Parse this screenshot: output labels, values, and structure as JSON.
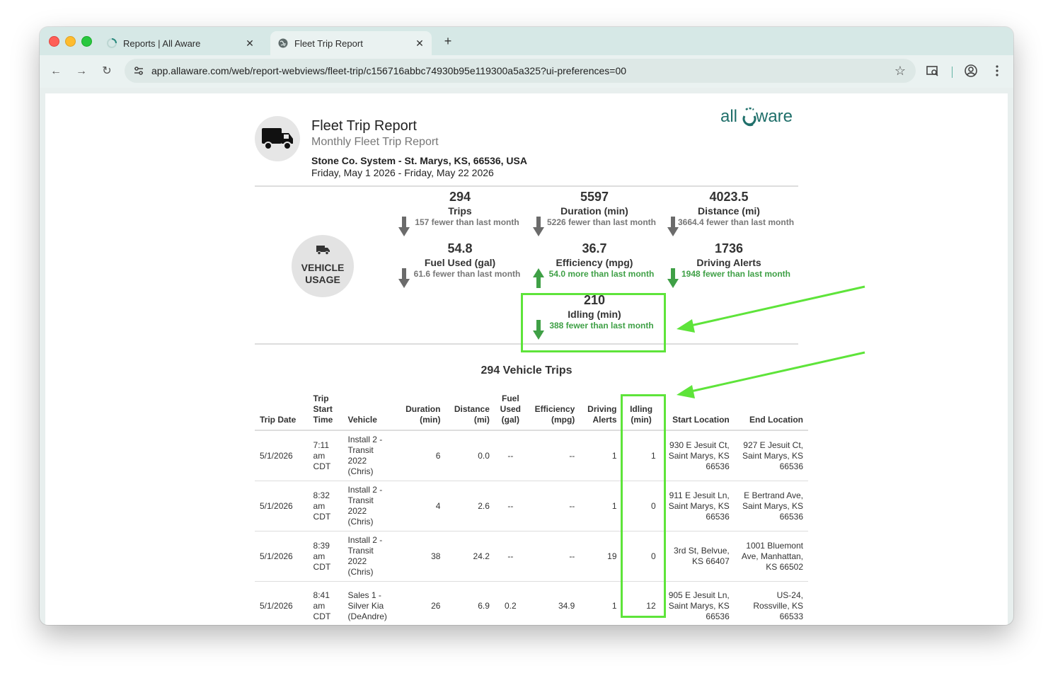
{
  "browser": {
    "tabs": [
      {
        "title": "Reports | All Aware",
        "icon": "loading-spinner-icon"
      },
      {
        "title": "Fleet Trip Report",
        "icon": "globe-icon"
      }
    ],
    "url": "app.allaware.com/web/report-webviews/fleet-trip/c156716abbc74930b95e119300a5a325?ui-preferences=00"
  },
  "report": {
    "title": "Fleet Trip Report",
    "subtitle": "Monthly Fleet Trip Report",
    "organization": "Stone Co. System - St. Marys, KS, 66536, USA",
    "date_range": "Friday, May 1 2026 - Friday, May 22 2026",
    "logo_text": "all aware"
  },
  "vehicle_usage": {
    "label_line1": "VEHICLE",
    "label_line2": "USAGE",
    "stats": [
      {
        "value": "294",
        "label": "Trips",
        "change": "157 fewer than last month",
        "direction": "down",
        "color": "gray"
      },
      {
        "value": "5597",
        "label": "Duration (min)",
        "change": "5226 fewer than last month",
        "direction": "down",
        "color": "gray"
      },
      {
        "value": "4023.5",
        "label": "Distance (mi)",
        "change": "3664.4 fewer than last month",
        "direction": "down",
        "color": "gray"
      },
      {
        "value": "54.8",
        "label": "Fuel Used (gal)",
        "change": "61.6 fewer than last month",
        "direction": "down",
        "color": "gray"
      },
      {
        "value": "36.7",
        "label": "Efficiency (mpg)",
        "change": "54.0 more than last month",
        "direction": "up",
        "color": "green"
      },
      {
        "value": "1736",
        "label": "Driving Alerts",
        "change": "1948 fewer than last month",
        "direction": "down",
        "color": "green"
      },
      {
        "value": "210",
        "label": "Idling (min)",
        "change": "388 fewer than last month",
        "direction": "down",
        "color": "green"
      }
    ]
  },
  "trips": {
    "title": "294 Vehicle Trips",
    "headers": [
      "Trip Date",
      "Trip Start Time",
      "Vehicle",
      "Duration (min)",
      "Distance (mi)",
      "Fuel Used (gal)",
      "Efficiency (mpg)",
      "Driving Alerts",
      "Idling (min)",
      "Start Location",
      "End Location"
    ],
    "rows": [
      [
        "5/1/2026",
        "7:11 am CDT",
        "Install 2 - Transit 2022 (Chris)",
        "6",
        "0.0",
        "--",
        "--",
        "1",
        "1",
        "930 E Jesuit Ct, Saint Marys, KS 66536",
        "927 E Jesuit Ct, Saint Marys, KS 66536"
      ],
      [
        "5/1/2026",
        "8:32 am CDT",
        "Install 2 - Transit 2022 (Chris)",
        "4",
        "2.6",
        "--",
        "--",
        "1",
        "0",
        "911 E Jesuit Ln, Saint Marys, KS 66536",
        "E Bertrand Ave, Saint Marys, KS 66536"
      ],
      [
        "5/1/2026",
        "8:39 am CDT",
        "Install 2 - Transit 2022 (Chris)",
        "38",
        "24.2",
        "--",
        "--",
        "19",
        "0",
        "3rd St, Belvue, KS 66407",
        "1001 Bluemont Ave, Manhattan, KS 66502"
      ],
      [
        "5/1/2026",
        "8:41 am CDT",
        "Sales 1 - Silver Kia (DeAndre)",
        "26",
        "6.9",
        "0.2",
        "34.9",
        "1",
        "12",
        "905 E Jesuit Ln, Saint Marys, KS 66536",
        "US-24, Rossville, KS 66533"
      ]
    ]
  },
  "colors": {
    "highlight": "#5ee43a",
    "positive": "#3fa046",
    "neutral_arrow": "#6b6b6b",
    "logo_teal": "#1f6f6a"
  }
}
